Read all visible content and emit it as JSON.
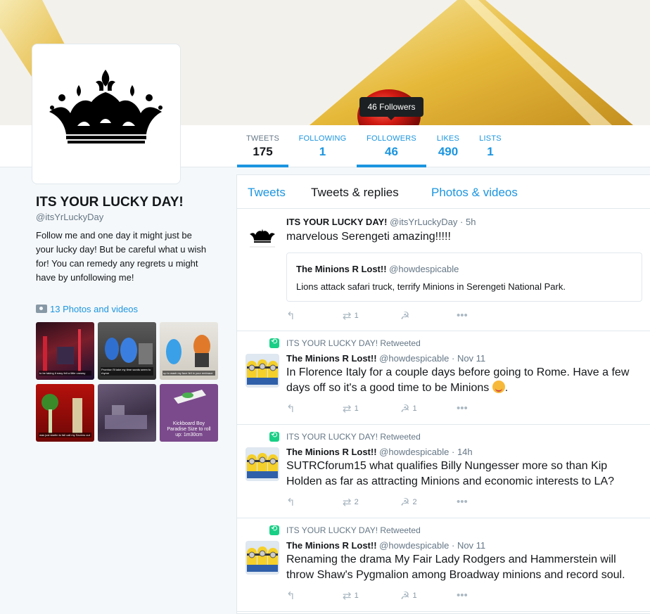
{
  "profile": {
    "name": "ITS YOUR LUCKY DAY!",
    "handle": "@itsYrLuckyDay",
    "bio": "Follow me and one day it might just be your lucky day! But be careful what u wish for! You can remedy any regrets u might have by unfollowing me!",
    "photos_link": "13 Photos and videos",
    "avatar_icon": "crown-icon"
  },
  "tooltip": "46 Followers",
  "stats": [
    {
      "label": "TWEETS",
      "value": "175"
    },
    {
      "label": "FOLLOWING",
      "value": "1"
    },
    {
      "label": "FOLLOWERS",
      "value": "46"
    },
    {
      "label": "LIKES",
      "value": "490"
    },
    {
      "label": "LISTS",
      "value": "1"
    }
  ],
  "thumb_captions": {
    "t1": "to be taking it easy felt a little uneasy",
    "t2": "Promise I'll take my time words seem to rhyme",
    "t3": "up to wash my face fell in your embrace",
    "t4": "was just startin to fall call my Sevens out",
    "t6": "Kickboard Boy Paradise Size to roll up: 1m30cm"
  },
  "tabs": {
    "tweets": "Tweets",
    "replies": "Tweets & replies",
    "media": "Photos & videos"
  },
  "tweets": [
    {
      "name": "ITS YOUR LUCKY DAY!",
      "handle": "@itsYrLuckyDay",
      "time": "· 5h",
      "text": "marvelous Serengeti amazing!!!!!",
      "quote": {
        "name": "The Minions R Lost!!",
        "handle": "@howdespicable",
        "text": "Lions attack safari truck, terrify Minions in Serengeti National Park."
      },
      "retweets": "1",
      "likes": ""
    },
    {
      "rt_by": "ITS YOUR LUCKY DAY! Retweeted",
      "name": "The Minions R Lost!!",
      "handle": "@howdespicable",
      "time": "· Nov 11",
      "text": "In Florence Italy for a couple days before going to Rome. Have a few days off so it's a good time to be Minions",
      "retweets": "1",
      "likes": "1"
    },
    {
      "rt_by": "ITS YOUR LUCKY DAY! Retweeted",
      "name": "The Minions R Lost!!",
      "handle": "@howdespicable",
      "time": "· 14h",
      "text": "SUTRCforum15 what qualifies Billy Nungesser more so than Kip Holden as far as attracting Minions and economic interests to LA?",
      "retweets": "2",
      "likes": "2"
    },
    {
      "rt_by": "ITS YOUR LUCKY DAY! Retweeted",
      "name": "The Minions R Lost!!",
      "handle": "@howdespicable",
      "time": "· Nov 11",
      "text": "Renaming the drama My Fair Lady Rodgers and Hammerstein will throw Shaw's Pygmalion among Broadway minions and record soul.",
      "retweets": "1",
      "likes": "1"
    }
  ],
  "icons": {
    "reply": "reply-icon",
    "retweet": "retweet-icon",
    "like": "like-icon",
    "more": "more-icon",
    "camera": "camera-icon"
  },
  "colors": {
    "accent": "#1b95e0",
    "retweet_green": "#19cf86",
    "background": "#f5f8fa"
  }
}
